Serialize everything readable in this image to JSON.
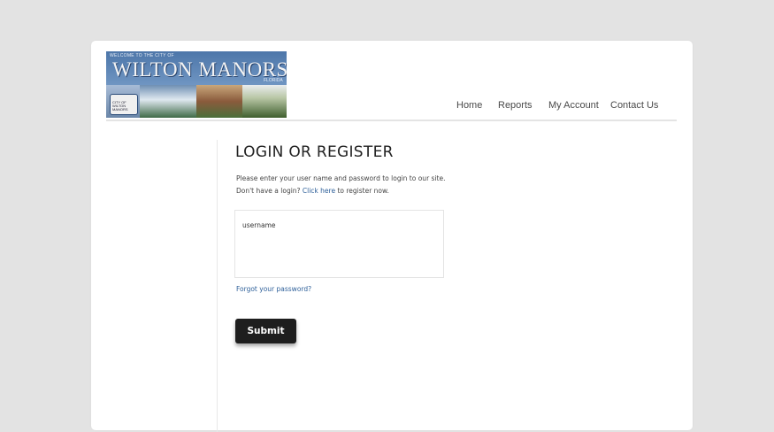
{
  "logo": {
    "welcome": "WELCOME TO THE CITY OF",
    "title": "WILTON MANORS",
    "state": "FLORIDA",
    "seal_text": "CITY OF WILTON MANORS"
  },
  "nav": {
    "items": [
      "Home",
      "Reports",
      "My Account",
      "Contact Us"
    ]
  },
  "login": {
    "heading": "LOGIN OR REGISTER",
    "intro_line1": "Please enter your user name and password to login to our site.",
    "intro_line2_prefix": "Don't have a login? ",
    "intro_line2_link": "Click here",
    "intro_line2_suffix": " to register now.",
    "username_placeholder": "username",
    "forgot_link": "Forgot your password?",
    "submit_label": "Submit"
  },
  "colors": {
    "page_bg": "#e3e3e3",
    "link": "#2d5f99",
    "button_bg": "#1e1e1e"
  }
}
